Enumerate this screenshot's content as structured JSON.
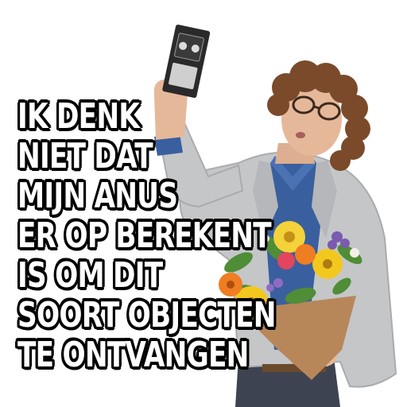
{
  "caption": {
    "lines": [
      "IK DENK",
      "NIET DAT",
      "MIJN ANUS",
      "ER OP BEREKENT",
      "IS OM DIT",
      "SOORT OBJECTEN",
      "TE  ONTVANGEN"
    ]
  },
  "colors": {
    "background": "#ffffff",
    "caption_fill": "#ffffff",
    "caption_outline": "#000000",
    "jacket": "#c4c6c8",
    "shirt": "#3a5f9e",
    "hair": "#7a4a2a",
    "skin": "#e6b89a",
    "cassette": "#2a2a2a",
    "bouquet_yellow": "#f2c81e",
    "bouquet_orange": "#ef7d22",
    "bouquet_pink": "#e2455e",
    "bouquet_purple": "#7a5bb0",
    "leaves": "#4f8d36",
    "wrapping": "#b7875a"
  },
  "icons": {
    "cassette": "vhs-cassette-icon",
    "bouquet": "flower-bouquet"
  }
}
